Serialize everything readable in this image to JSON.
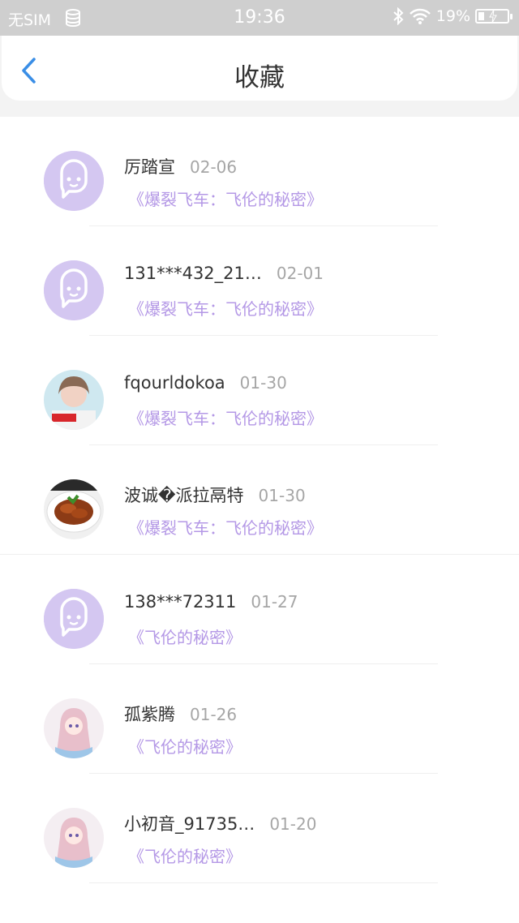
{
  "status_bar": {
    "carrier": "无SIM",
    "time": "19:36",
    "battery": "19%",
    "battery_level": 0.19,
    "icons": [
      "database-icon",
      "bluetooth-icon",
      "wifi-icon",
      "battery-icon"
    ]
  },
  "header": {
    "title": "收藏",
    "back_icon": "chevron-left-icon"
  },
  "colors": {
    "accent": "#3a8ee6",
    "book_title": "#b498e6",
    "default_avatar": "#d4c7f1"
  },
  "favorites": [
    {
      "name": "厉踏宣",
      "date": "02-06",
      "book": "《爆裂飞车：飞伦的秘密》",
      "avatar": "default-avatar"
    },
    {
      "name": "131***432_21…",
      "date": "02-01",
      "book": "《爆裂飞车：飞伦的秘密》",
      "avatar": "default-avatar"
    },
    {
      "name": "fqourldokoa",
      "date": "01-30",
      "book": "《爆裂飞车：飞伦的秘密》",
      "avatar": "photo-avatar"
    },
    {
      "name": "波诚�派拉鬲特",
      "date": "01-30",
      "book": "《爆裂飞车：飞伦的秘密》",
      "avatar": "food-avatar"
    },
    {
      "name": "138***72311",
      "date": "01-27",
      "book": "《飞伦的秘密》",
      "avatar": "default-avatar"
    },
    {
      "name": "孤紫腾",
      "date": "01-26",
      "book": "《飞伦的秘密》",
      "avatar": "anime-avatar"
    },
    {
      "name": "小初音_91735…",
      "date": "01-20",
      "book": "《飞伦的秘密》",
      "avatar": "anime-avatar"
    }
  ]
}
